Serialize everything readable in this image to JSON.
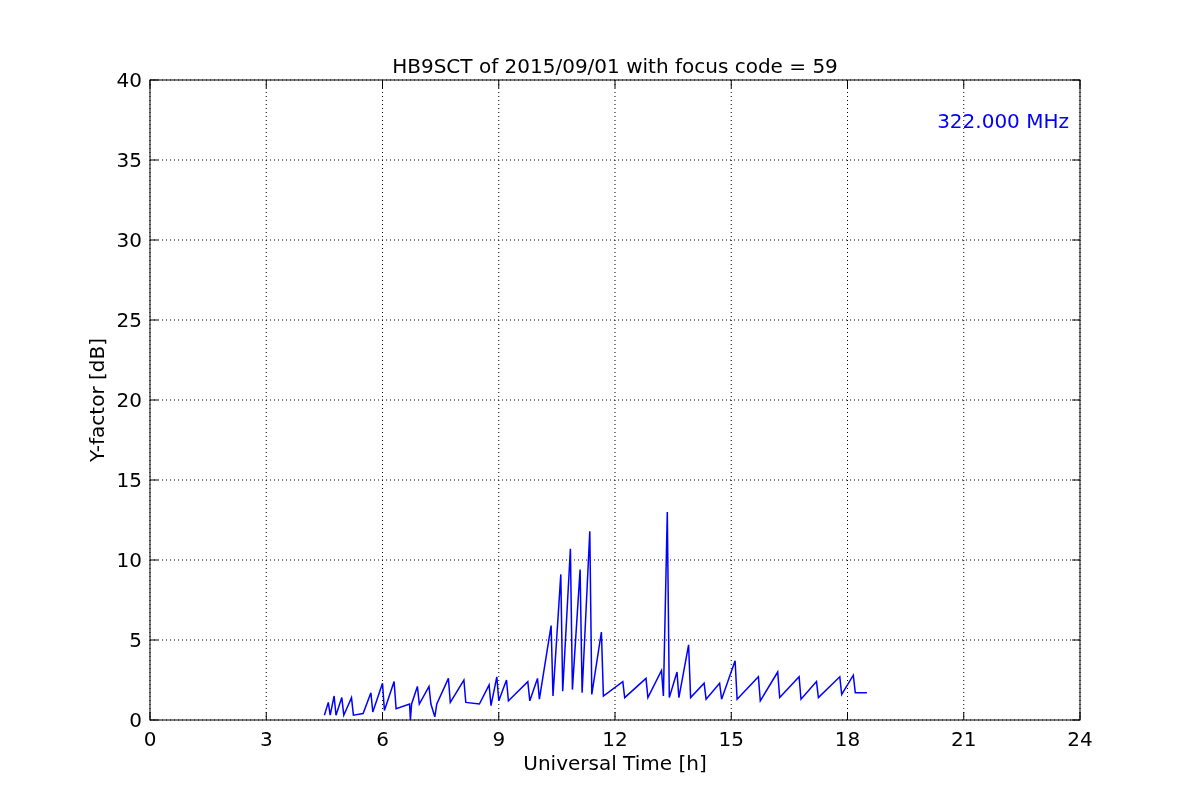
{
  "chart_data": {
    "type": "line",
    "title": "HB9SCT of 2015/09/01 with focus code = 59",
    "xlabel": "Universal Time [h]",
    "ylabel": "Y-factor [dB]",
    "xlim": [
      0,
      24
    ],
    "ylim": [
      0,
      40
    ],
    "xticks": [
      0,
      3,
      6,
      9,
      12,
      15,
      18,
      21,
      24
    ],
    "yticks": [
      0,
      5,
      10,
      15,
      20,
      25,
      30,
      35,
      40
    ],
    "x": [
      4.5,
      4.6,
      4.65,
      4.75,
      4.8,
      4.95,
      5.0,
      5.2,
      5.25,
      5.5,
      5.7,
      5.75,
      6.0,
      6.05,
      6.3,
      6.35,
      6.7,
      6.72,
      6.75,
      6.9,
      6.95,
      7.2,
      7.25,
      7.35,
      7.4,
      7.7,
      7.75,
      8.1,
      8.15,
      8.5,
      8.75,
      8.8,
      8.95,
      9.0,
      9.2,
      9.25,
      9.75,
      9.8,
      10.0,
      10.05,
      10.35,
      10.4,
      10.6,
      10.65,
      10.85,
      10.9,
      11.1,
      11.15,
      11.35,
      11.4,
      11.65,
      11.7,
      12.2,
      12.25,
      12.8,
      12.85,
      13.2,
      13.25,
      13.35,
      13.4,
      13.6,
      13.65,
      13.9,
      13.95,
      14.3,
      14.35,
      14.7,
      14.75,
      15.1,
      15.15,
      15.7,
      15.75,
      16.2,
      16.25,
      16.75,
      16.8,
      17.2,
      17.25,
      17.8,
      17.85,
      18.15,
      18.2,
      18.5
    ],
    "series": [
      {
        "name": "322.000 MHz",
        "color": "#0000ff",
        "values": [
          0.3,
          1.1,
          0.3,
          1.5,
          0.3,
          1.4,
          0.3,
          1.4,
          0.3,
          0.4,
          1.7,
          0.5,
          2.3,
          0.6,
          2.4,
          0.7,
          1.0,
          0.0,
          1.0,
          2.1,
          1.0,
          2.1,
          1.0,
          0.2,
          1.0,
          2.6,
          1.1,
          2.5,
          1.1,
          1.0,
          2.2,
          0.9,
          2.7,
          1.2,
          2.5,
          1.2,
          2.4,
          1.2,
          2.6,
          1.3,
          5.9,
          1.5,
          9.1,
          1.8,
          10.7,
          1.9,
          9.4,
          1.7,
          11.8,
          1.6,
          5.5,
          1.5,
          2.4,
          1.4,
          2.6,
          1.4,
          3.1,
          1.5,
          13.0,
          1.4,
          3.0,
          1.4,
          4.7,
          1.4,
          2.3,
          1.3,
          2.3,
          1.3,
          3.7,
          1.3,
          2.7,
          1.2,
          3.0,
          1.4,
          2.7,
          1.3,
          2.4,
          1.4,
          2.7,
          1.6,
          2.8,
          1.7,
          1.7
        ]
      }
    ],
    "grid": true
  }
}
